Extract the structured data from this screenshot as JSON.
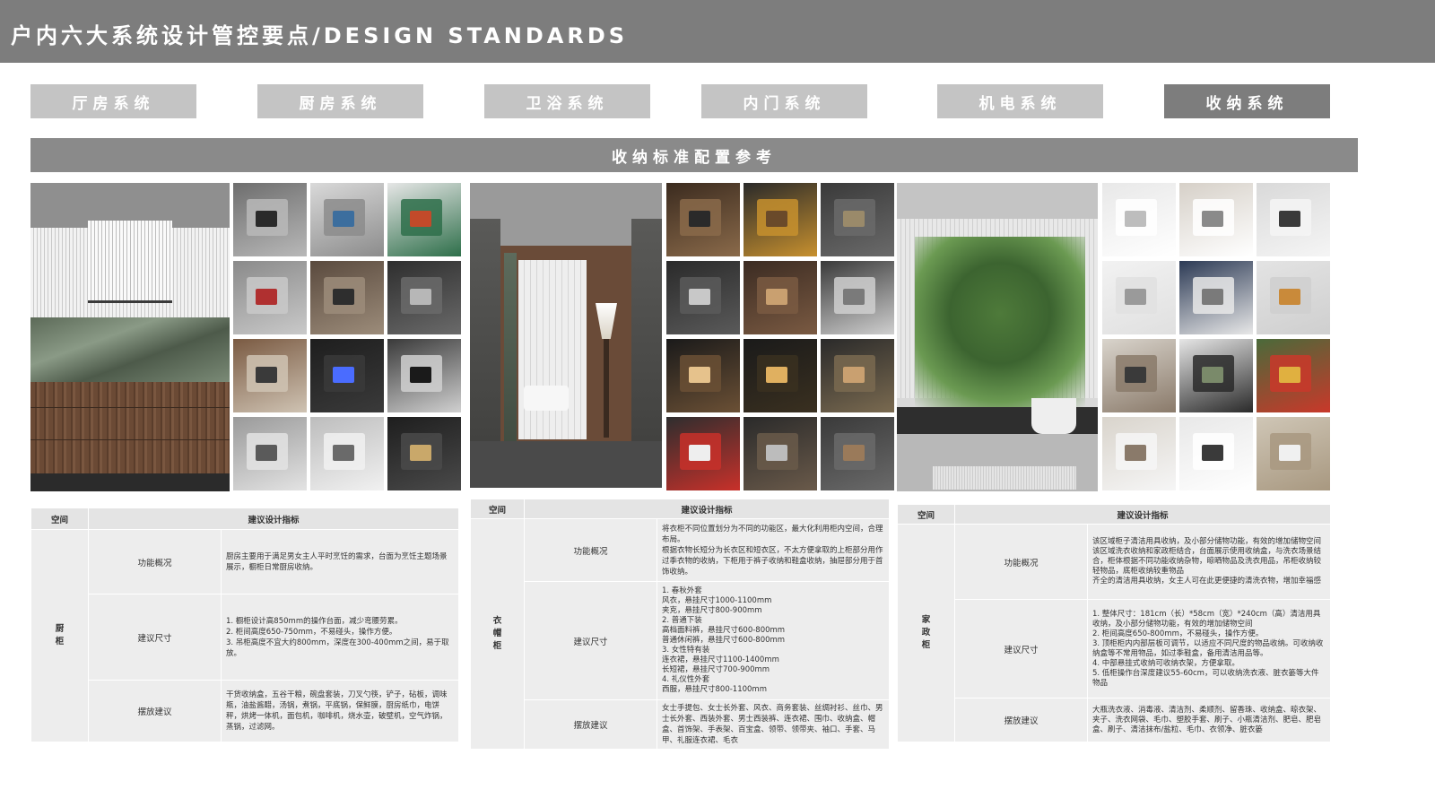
{
  "header": {
    "title": "户内六大系统设计管控要点/DESIGN STANDARDS"
  },
  "tabs": [
    {
      "label": "厅房系统",
      "active": false
    },
    {
      "label": "厨房系统",
      "active": false
    },
    {
      "label": "卫浴系统",
      "active": false
    },
    {
      "label": "内门系统",
      "active": false
    },
    {
      "label": "机电系统",
      "active": false
    },
    {
      "label": "收纳系统",
      "active": true
    }
  ],
  "banner": {
    "title": "收纳标准配置参考"
  },
  "colors": {
    "header_bg": "#7d7d7d",
    "tab_bg": "#c4c4c4",
    "tab_active_bg": "#7d7d7d",
    "banner_bg": "#8a8a8a",
    "table_bg": "#ededed"
  },
  "panels": [
    {
      "images": {
        "main": "kitchen-cabinet-render",
        "thumbs": [
          "sink-basket-photo",
          "faucet-photo",
          "bottle-rack-photo",
          "water-purifier-photo",
          "corner-drawer-photo",
          "dishwasher-drawer-photo",
          "pull-out-rack-photo",
          "induction-hob-photo",
          "dish-rack-photo",
          "lift-basket-photo",
          "pull-basket-photo",
          "drawer-organizer-photo"
        ]
      },
      "table": {
        "head": {
          "space": "空间",
          "metric": "建议设计指标"
        },
        "space": "厨\n柜",
        "rows": [
          {
            "label": "功能概况",
            "text": "厨房主要用于满足男女主人平时烹饪的需求，台面为烹饪主题场景展示，橱柜日常厨房收纳。"
          },
          {
            "label": "建议尺寸",
            "text": "1. 橱柜设计高850mm的操作台面，减少弯腰劳累。\n2. 柜间高度650-750mm，不易碰头，操作方便。\n3. 吊柜高度不宜大约800mm，深度在300-400mm之间，易于取放。"
          },
          {
            "label": "摆放建议",
            "text": "干货收纳盒，五谷干粮，碗盘套装，刀叉勺筷，铲子，砧板，调味瓶，油盐酱醋，汤锅，煮锅，平底锅，保鲜膜，厨房纸巾，电饼秤，烘烤一体机，面包机，咖啡机，烧水壶，破壁机，空气炸锅，蒸锅，过滤网。"
          }
        ]
      }
    },
    {
      "images": {
        "main": "wardrobe-corridor-render",
        "thumbs": [
          "hanging-rod-photo",
          "jewelry-tray-photo",
          "pull-out-shelf-photo",
          "watch-drawer-photo",
          "drawer-grid-photo",
          "closet-interior-photo",
          "lit-cabinet-photo",
          "wall-lamp-photo",
          "glass-shelf-photo",
          "red-drawer-photo",
          "accessory-tray-photo",
          "tie-drawer-photo"
        ]
      },
      "table": {
        "head": {
          "space": "空间",
          "metric": "建议设计指标"
        },
        "space": "衣\n帽\n柜",
        "rows": [
          {
            "label": "功能概况",
            "text": "将衣柜不同位置划分为不同的功能区，最大化利用柜内空间，合理布局。\n根据衣物长短分为长衣区和短衣区，不太方便拿取的上柜部分用作过季衣物的收纳，下柜用于裤子收纳和鞋盒收纳，抽屉部分用于首饰收纳。"
          },
          {
            "label": "建议尺寸",
            "text": "1. 春秋外套\n风衣，悬挂尺寸1000-1100mm\n夹克，悬挂尺寸800-900mm\n2. 普通下装\n高档面料裤，悬挂尺寸600-800mm\n普通休闲裤，悬挂尺寸600-800mm\n3. 女性特有装\n连衣裙，悬挂尺寸1100-1400mm\n长短裙，悬挂尺寸700-900mm\n4. 礼仪性外套\n西服，悬挂尺寸800-1100mm"
          },
          {
            "label": "摆放建议",
            "text": "女士手提包、女士长外套、风衣、商务套装、丝绸衬衫、丝巾、男士长外套、西装外套、男士西装裤、连衣裙、围巾、收纳盒、帽盒、首饰架、手表架、百宝盒、领带、领带夹、袖口、手套、马甲、礼服连衣裙、毛衣"
          }
        ]
      }
    },
    {
      "images": {
        "main": "balcony-plants-render",
        "thumbs": [
          "laundry-cabinet-photo",
          "washer-dryer-photo",
          "utility-closet-photo",
          "drying-rack-photo",
          "tall-cabinet-photo",
          "pet-corner-photo",
          "exercise-bike-photo",
          "lounge-chair-photo",
          "plant-shelf-photo",
          "towel-shelf-photo",
          "jar-storage-photo",
          "basket-storage-photo"
        ]
      },
      "table": {
        "head": {
          "space": "空间",
          "metric": "建议设计指标"
        },
        "space": "家\n政\n柜",
        "rows": [
          {
            "label": "功能概况",
            "text": "该区域柜子清洁用具收纳，及小部分储物功能，有效的增加储物空间\n该区域洗衣收纳和家政柜结合，台面展示使用收纳盒，与洗衣场景结合，柜体根据不同功能收纳杂物，晾晒物品及洗衣用品，吊柜收纳较轻物品，底柜收纳较重物品\n齐全的清洁用具收纳，女主人可在此更便捷的清洗衣物，增加幸福感"
          },
          {
            "label": "建议尺寸",
            "text": "1. 整体尺寸：181cm（长）*58cm（宽）*240cm（高）清洁用具收纳，及小部分储物功能，有效的增加储物空间\n2. 柜间高度650-800mm，不易碰头，操作方便。\n3. 顶柜柜内内部层板可调节，以适应不同尺度的物品收纳。可收纳收纳盒等不常用物品，如过季鞋盒，备用清洁用品等。\n4. 中部悬挂式收纳可收纳衣架，方便拿取。\n5. 低柜操作台深度建议55-60cm，可以收纳洗衣液、脏衣篓等大件物品"
          },
          {
            "label": "摆放建议",
            "text": "大瓶洗衣液、消毒液、清洁剂、柔顺剂、留香珠、收纳盒、晾衣架、夹子、洗衣网袋、毛巾、塑胶手套、刷子、小瓶清洁剂、肥皂、肥皂盒、刷子、清洁抹布/盐粒、毛巾、衣领净、脏衣篓"
          }
        ]
      }
    }
  ]
}
